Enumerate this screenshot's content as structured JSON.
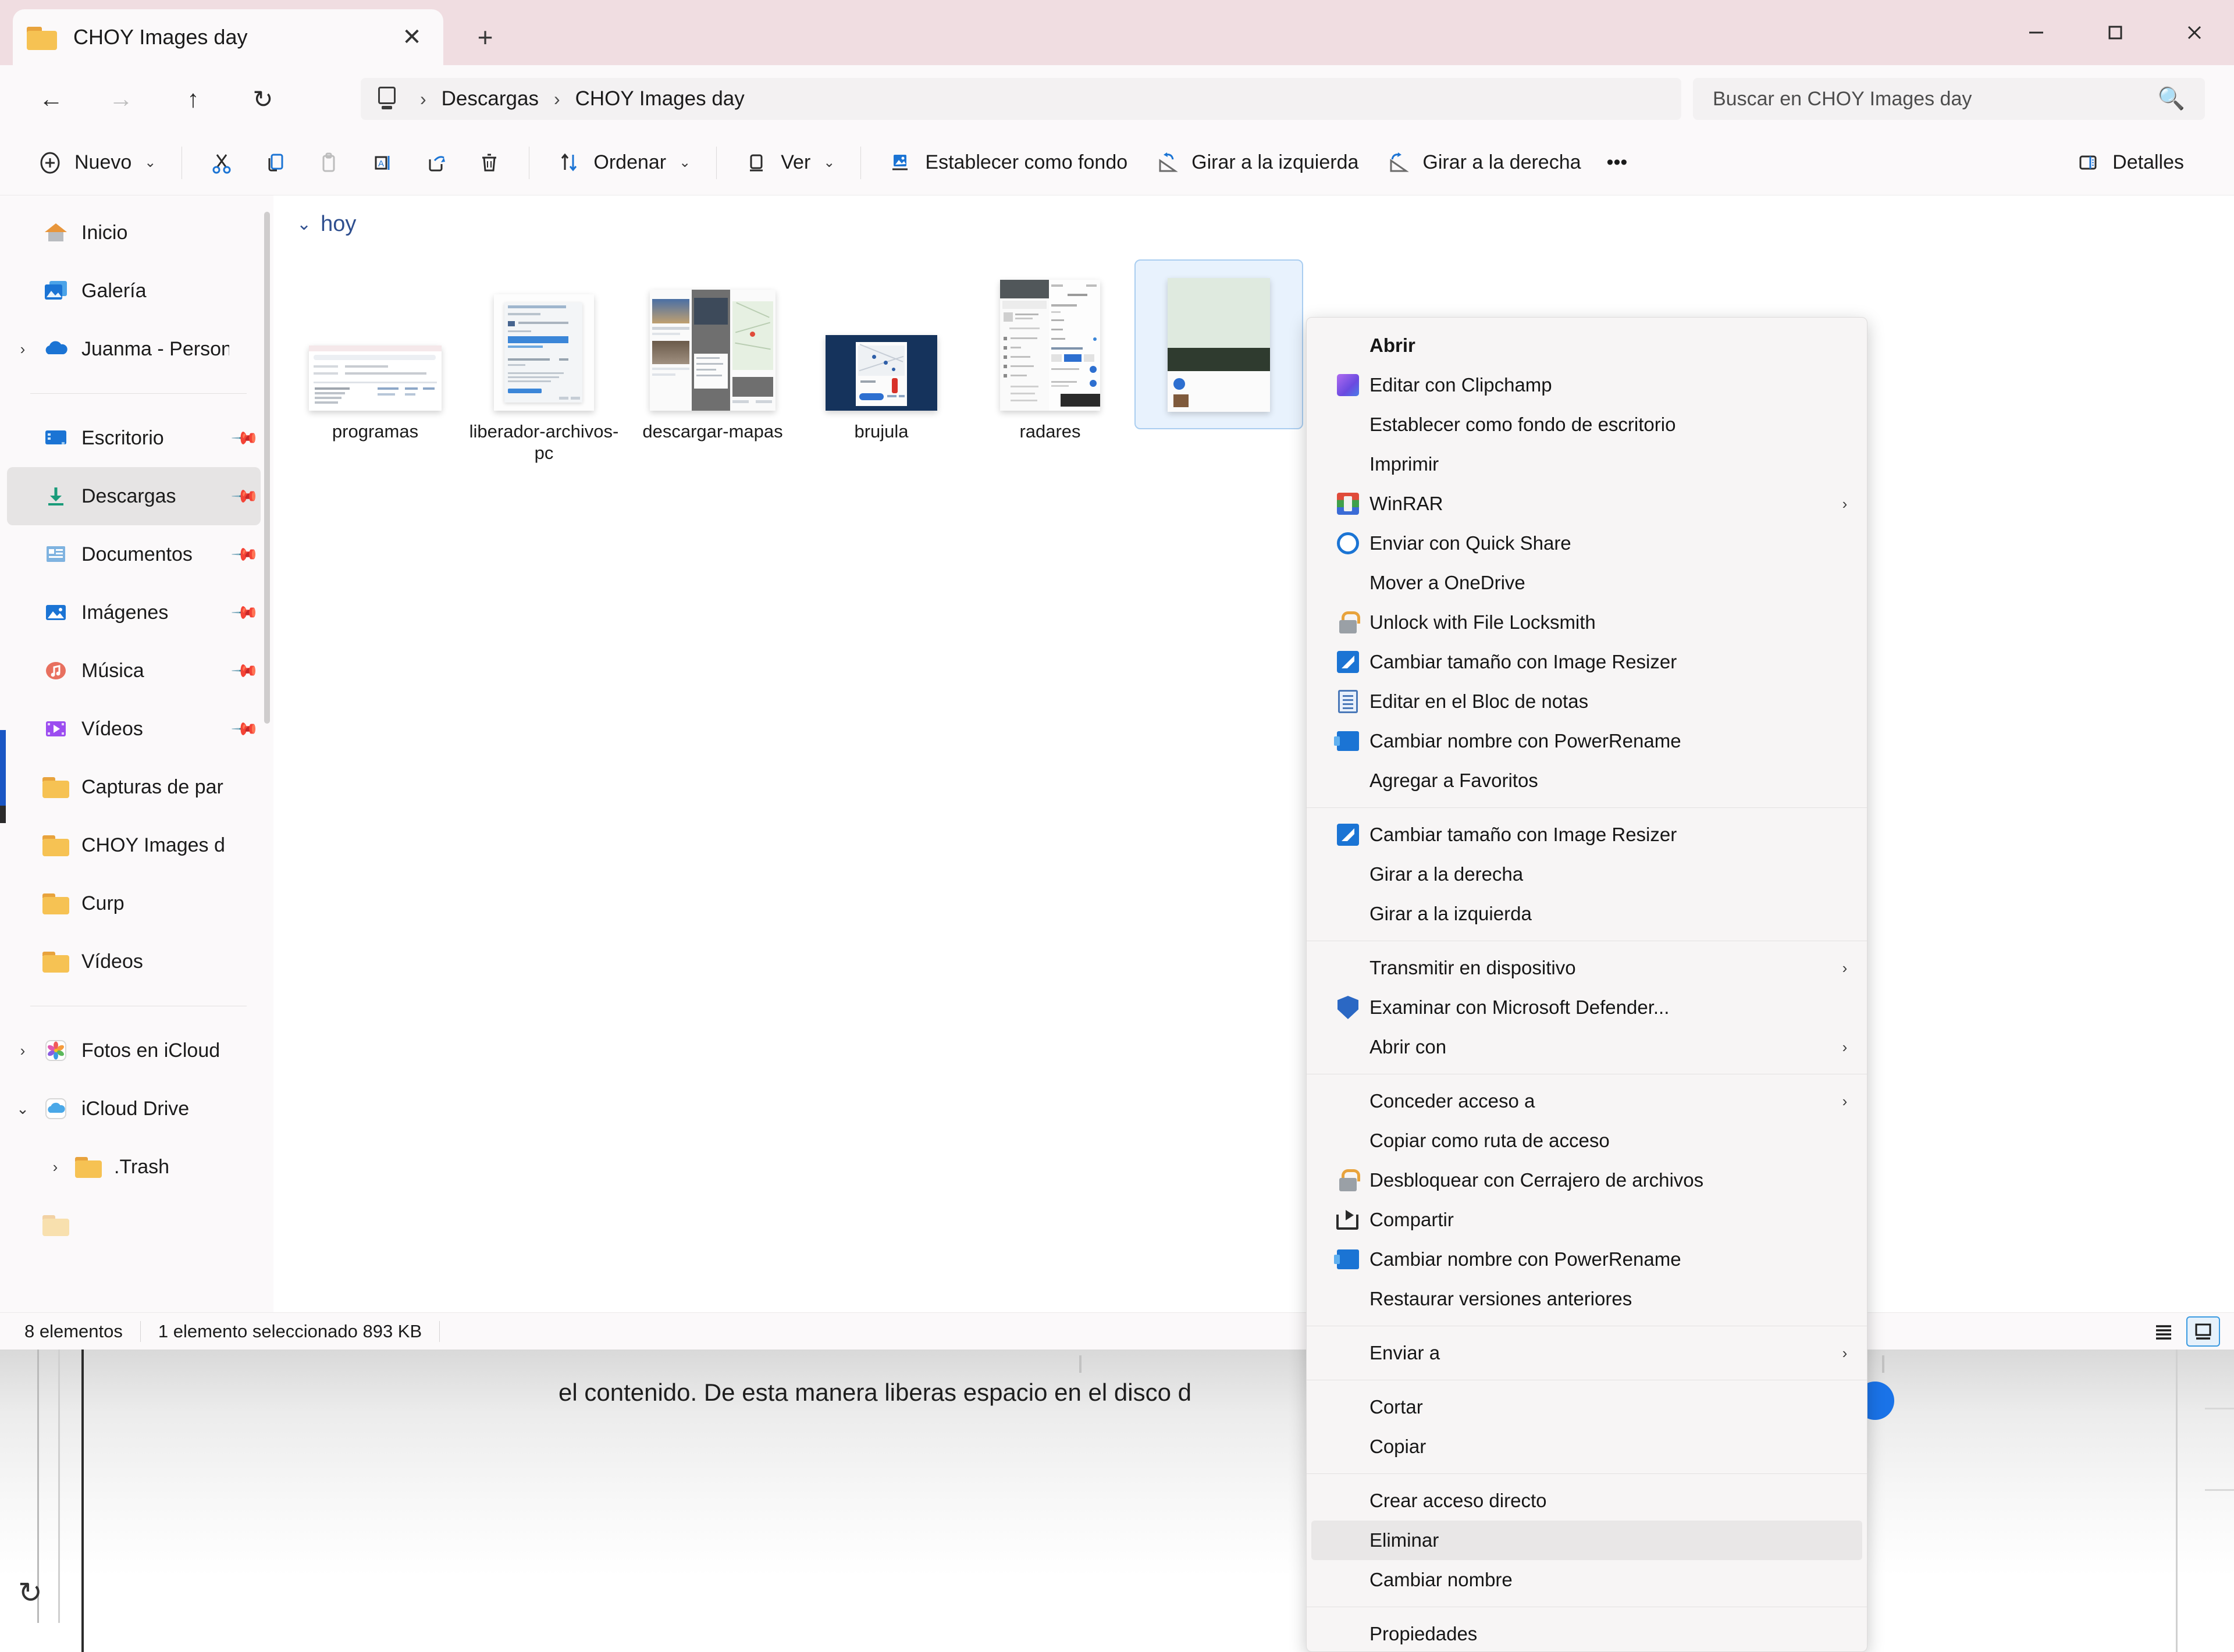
{
  "window": {
    "tab_title": "CHOY Images day",
    "tab_close_icon": "close-icon",
    "new_tab_icon": "plus-icon",
    "minimize_icon": "minimize-icon",
    "maximize_icon": "maximize-icon",
    "close_icon": "close-icon"
  },
  "addressbar": {
    "back_icon": "arrow-left-icon",
    "forward_icon": "arrow-right-icon",
    "up_icon": "arrow-up-icon",
    "refresh_icon": "refresh-icon",
    "pc_icon": "this-pc-icon",
    "crumbs": [
      "Descargas",
      "CHOY Images day"
    ],
    "separator": "›"
  },
  "search": {
    "placeholder": "Buscar en CHOY Images day",
    "value": "",
    "icon": "search-icon"
  },
  "toolbar": {
    "new_label": "Nuevo",
    "new_icon": "plus-circle-icon",
    "cut_icon": "scissors-icon",
    "copy_icon": "copy-icon",
    "paste_icon": "paste-icon",
    "rename_icon": "rename-icon",
    "share_icon": "share-icon",
    "delete_icon": "trash-icon",
    "sort_label": "Ordenar",
    "sort_icon": "sort-icon",
    "view_label": "Ver",
    "view_icon": "view-icon",
    "wallpaper_label": "Establecer como fondo",
    "wallpaper_icon": "wallpaper-icon",
    "rotate_left_label": "Girar a la izquierda",
    "rotate_left_icon": "rotate-left-icon",
    "rotate_right_label": "Girar a la derecha",
    "rotate_right_icon": "rotate-right-icon",
    "overflow_label": "•••",
    "details_label": "Detalles",
    "details_icon": "details-pane-icon",
    "chevron": "⌄"
  },
  "sidebar": {
    "items": [
      {
        "label": "Inicio",
        "icon": "home-icon",
        "chevron": "",
        "pinned": false,
        "selected": false
      },
      {
        "label": "Galería",
        "icon": "gallery-icon",
        "chevron": "",
        "pinned": false,
        "selected": false
      },
      {
        "label": "Juanma - Person",
        "icon": "onedrive-icon",
        "chevron": "›",
        "pinned": false,
        "selected": false
      },
      {
        "divider": true
      },
      {
        "label": "Escritorio",
        "icon": "desktop-icon",
        "chevron": "",
        "pinned": true,
        "selected": false
      },
      {
        "label": "Descargas",
        "icon": "downloads-icon",
        "chevron": "",
        "pinned": true,
        "selected": true
      },
      {
        "label": "Documentos",
        "icon": "documents-icon",
        "chevron": "",
        "pinned": true,
        "selected": false
      },
      {
        "label": "Imágenes",
        "icon": "pictures-icon",
        "chevron": "",
        "pinned": true,
        "selected": false
      },
      {
        "label": "Música",
        "icon": "music-icon",
        "chevron": "",
        "pinned": true,
        "selected": false
      },
      {
        "label": "Vídeos",
        "icon": "videos-icon",
        "chevron": "",
        "pinned": true,
        "selected": false
      },
      {
        "label": "Capturas de par",
        "icon": "folder-icon",
        "chevron": "",
        "pinned": false,
        "selected": false
      },
      {
        "label": "CHOY Images d",
        "icon": "folder-icon",
        "chevron": "",
        "pinned": false,
        "selected": false
      },
      {
        "label": "Curp",
        "icon": "folder-icon",
        "chevron": "",
        "pinned": false,
        "selected": false
      },
      {
        "label": "Vídeos",
        "icon": "folder-icon",
        "chevron": "",
        "pinned": false,
        "selected": false
      },
      {
        "divider": true
      },
      {
        "label": "Fotos en iCloud",
        "icon": "icloud-photos-icon",
        "chevron": "›",
        "pinned": false,
        "selected": false
      },
      {
        "label": "iCloud Drive",
        "icon": "icloud-drive-icon",
        "chevron": "⌄",
        "pinned": false,
        "selected": false
      },
      {
        "label": ".Trash",
        "icon": "folder-icon",
        "chevron": "›",
        "indent": true,
        "pinned": false,
        "selected": false
      }
    ]
  },
  "content": {
    "group_label": "hoy",
    "group_chevron": "⌄",
    "files": [
      {
        "name": "programas",
        "selected": false
      },
      {
        "name": "liberador-archivos-pc",
        "selected": false
      },
      {
        "name": "descargar-mapas",
        "selected": false
      },
      {
        "name": "brujula",
        "selected": false
      },
      {
        "name": "radares",
        "selected": false
      },
      {
        "name": "",
        "selected": true
      }
    ]
  },
  "statusbar": {
    "item_count": "8 elementos",
    "selection": "1 elemento seleccionado  893 KB",
    "list_view_icon": "list-view-icon",
    "detail_view_icon": "details-view-icon"
  },
  "context_menu": {
    "groups": [
      {
        "items": [
          {
            "label": "Abrir",
            "icon": "",
            "bold": true,
            "arrow": false
          },
          {
            "label": "Editar con Clipchamp",
            "icon": "clipchamp-icon",
            "arrow": false
          },
          {
            "label": "Establecer como fondo de escritorio",
            "icon": "",
            "arrow": false
          },
          {
            "label": "Imprimir",
            "icon": "",
            "arrow": false
          },
          {
            "label": "WinRAR",
            "icon": "winrar-icon",
            "arrow": true
          },
          {
            "label": "Enviar con Quick Share",
            "icon": "quickshare-icon",
            "arrow": false
          },
          {
            "label": "Mover a OneDrive",
            "icon": "",
            "arrow": false
          },
          {
            "label": "Unlock with File Locksmith",
            "icon": "lock-icon",
            "arrow": false
          },
          {
            "label": "Cambiar tamaño con Image Resizer",
            "icon": "image-resizer-icon",
            "arrow": false
          },
          {
            "label": "Editar en el Bloc de notas",
            "icon": "notepad-icon",
            "arrow": false
          },
          {
            "label": "Cambiar nombre con PowerRename",
            "icon": "powerrename-icon",
            "arrow": false
          },
          {
            "label": "Agregar a Favoritos",
            "icon": "",
            "arrow": false
          }
        ]
      },
      {
        "items": [
          {
            "label": "Cambiar tamaño con Image Resizer",
            "icon": "image-resizer-icon",
            "arrow": false
          },
          {
            "label": "Girar a la derecha",
            "icon": "",
            "arrow": false
          },
          {
            "label": "Girar a la izquierda",
            "icon": "",
            "arrow": false
          }
        ]
      },
      {
        "items": [
          {
            "label": "Transmitir en dispositivo",
            "icon": "",
            "arrow": true
          },
          {
            "label": "Examinar con Microsoft Defender...",
            "icon": "defender-icon",
            "arrow": false
          },
          {
            "label": "Abrir con",
            "icon": "",
            "arrow": true
          }
        ]
      },
      {
        "items": [
          {
            "label": "Conceder acceso a",
            "icon": "",
            "arrow": true
          },
          {
            "label": "Copiar como ruta de acceso",
            "icon": "",
            "arrow": false
          },
          {
            "label": "Desbloquear con Cerrajero de archivos",
            "icon": "lock-icon",
            "arrow": false
          },
          {
            "label": "Compartir",
            "icon": "share-icon",
            "arrow": false
          },
          {
            "label": "Cambiar nombre con PowerRename",
            "icon": "powerrename-icon",
            "arrow": false
          },
          {
            "label": "Restaurar versiones anteriores",
            "icon": "",
            "arrow": false
          }
        ]
      },
      {
        "items": [
          {
            "label": "Enviar a",
            "icon": "",
            "arrow": true
          }
        ]
      },
      {
        "items": [
          {
            "label": "Cortar",
            "icon": "",
            "arrow": false
          },
          {
            "label": "Copiar",
            "icon": "",
            "arrow": false
          }
        ]
      },
      {
        "items": [
          {
            "label": "Crear acceso directo",
            "icon": "",
            "arrow": false
          },
          {
            "label": "Eliminar",
            "icon": "",
            "arrow": false,
            "highlighted": true
          },
          {
            "label": "Cambiar nombre",
            "icon": "",
            "arrow": false
          }
        ]
      },
      {
        "items": [
          {
            "label": "Propiedades",
            "icon": "",
            "arrow": false
          }
        ]
      }
    ]
  },
  "background_page": {
    "text": "el contenido. De esta manera liberas espacio en el disco d",
    "refresh_icon": "refresh-icon"
  },
  "colors": {
    "titlebar": "#f0dde1",
    "accent": "#1a73e8",
    "selection": "#e8f2fd",
    "chrome": "#fbf9fa"
  }
}
